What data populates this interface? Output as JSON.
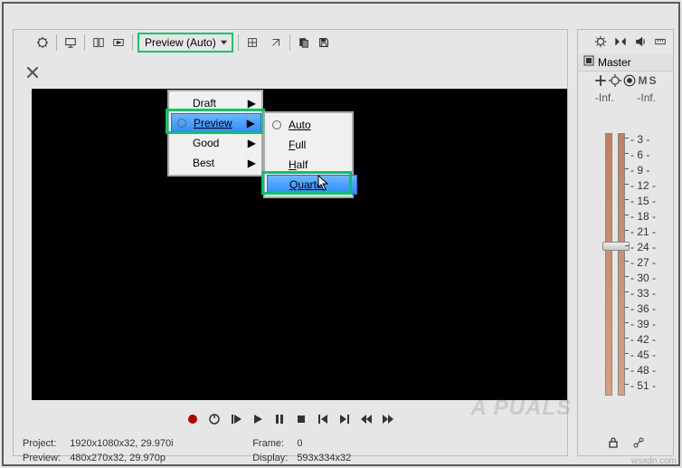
{
  "toolbar": {
    "preview_dd_label": "Preview (Auto)"
  },
  "quality_menu": {
    "items": [
      "Draft",
      "Preview",
      "Good",
      "Best"
    ],
    "selected_index": 1
  },
  "resolution_menu": {
    "items": [
      "Auto",
      "Full",
      "Half",
      "Quarter"
    ],
    "highlighted_index": 3
  },
  "transport": {},
  "status": {
    "project_label": "Project:",
    "project_value": "1920x1080x32, 29.970i",
    "preview_label": "Preview:",
    "preview_value": "480x270x32, 29.970p",
    "frame_label": "Frame:",
    "frame_value": "0",
    "display_label": "Display:",
    "display_value": "593x334x32"
  },
  "mixer": {
    "master_label": "Master",
    "mute": "M",
    "solo": "S",
    "inf_l": "-Inf.",
    "inf_r": "-Inf.",
    "scale": [
      "3",
      "6",
      "9",
      "12",
      "15",
      "18",
      "21",
      "24",
      "27",
      "30",
      "33",
      "36",
      "39",
      "42",
      "45",
      "48",
      "51"
    ]
  },
  "watermark": "A   PUALS",
  "attribution": "wsxdn.com"
}
